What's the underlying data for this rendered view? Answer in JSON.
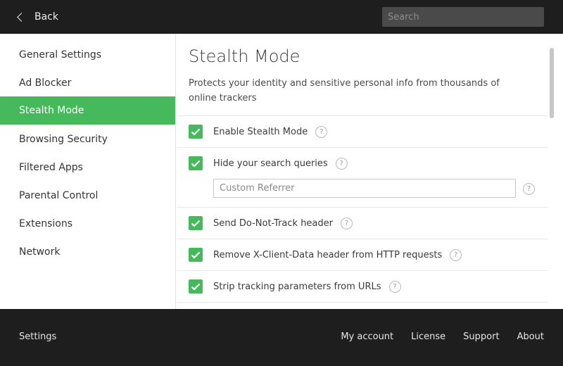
{
  "header": {
    "back_label": "Back",
    "search_placeholder": "Search"
  },
  "sidebar": {
    "items": [
      {
        "label": "General Settings",
        "active": false
      },
      {
        "label": "Ad Blocker",
        "active": false
      },
      {
        "label": "Stealth Mode",
        "active": true
      },
      {
        "label": "Browsing Security",
        "active": false
      },
      {
        "label": "Filtered Apps",
        "active": false
      },
      {
        "label": "Parental Control",
        "active": false
      },
      {
        "label": "Extensions",
        "active": false
      },
      {
        "label": "Network",
        "active": false
      }
    ]
  },
  "main": {
    "title": "Stealth Mode",
    "description": "Protects your identity and sensitive personal info from thousands of online trackers",
    "options": [
      {
        "label": "Enable Stealth Mode",
        "checked": true
      },
      {
        "label": "Hide your search queries",
        "checked": true
      },
      {
        "label": "Send Do-Not-Track header",
        "checked": true
      },
      {
        "label": "Remove X-Client-Data header from HTTP requests",
        "checked": true
      },
      {
        "label": "Strip tracking parameters from URLs",
        "checked": true
      }
    ],
    "referrer_placeholder": "Custom Referrer",
    "help_glyph": "?"
  },
  "footer": {
    "settings_label": "Settings",
    "links": [
      "My account",
      "License",
      "Support",
      "About"
    ]
  },
  "colors": {
    "accent": "#46b95c",
    "chrome": "#1e1e1e"
  }
}
